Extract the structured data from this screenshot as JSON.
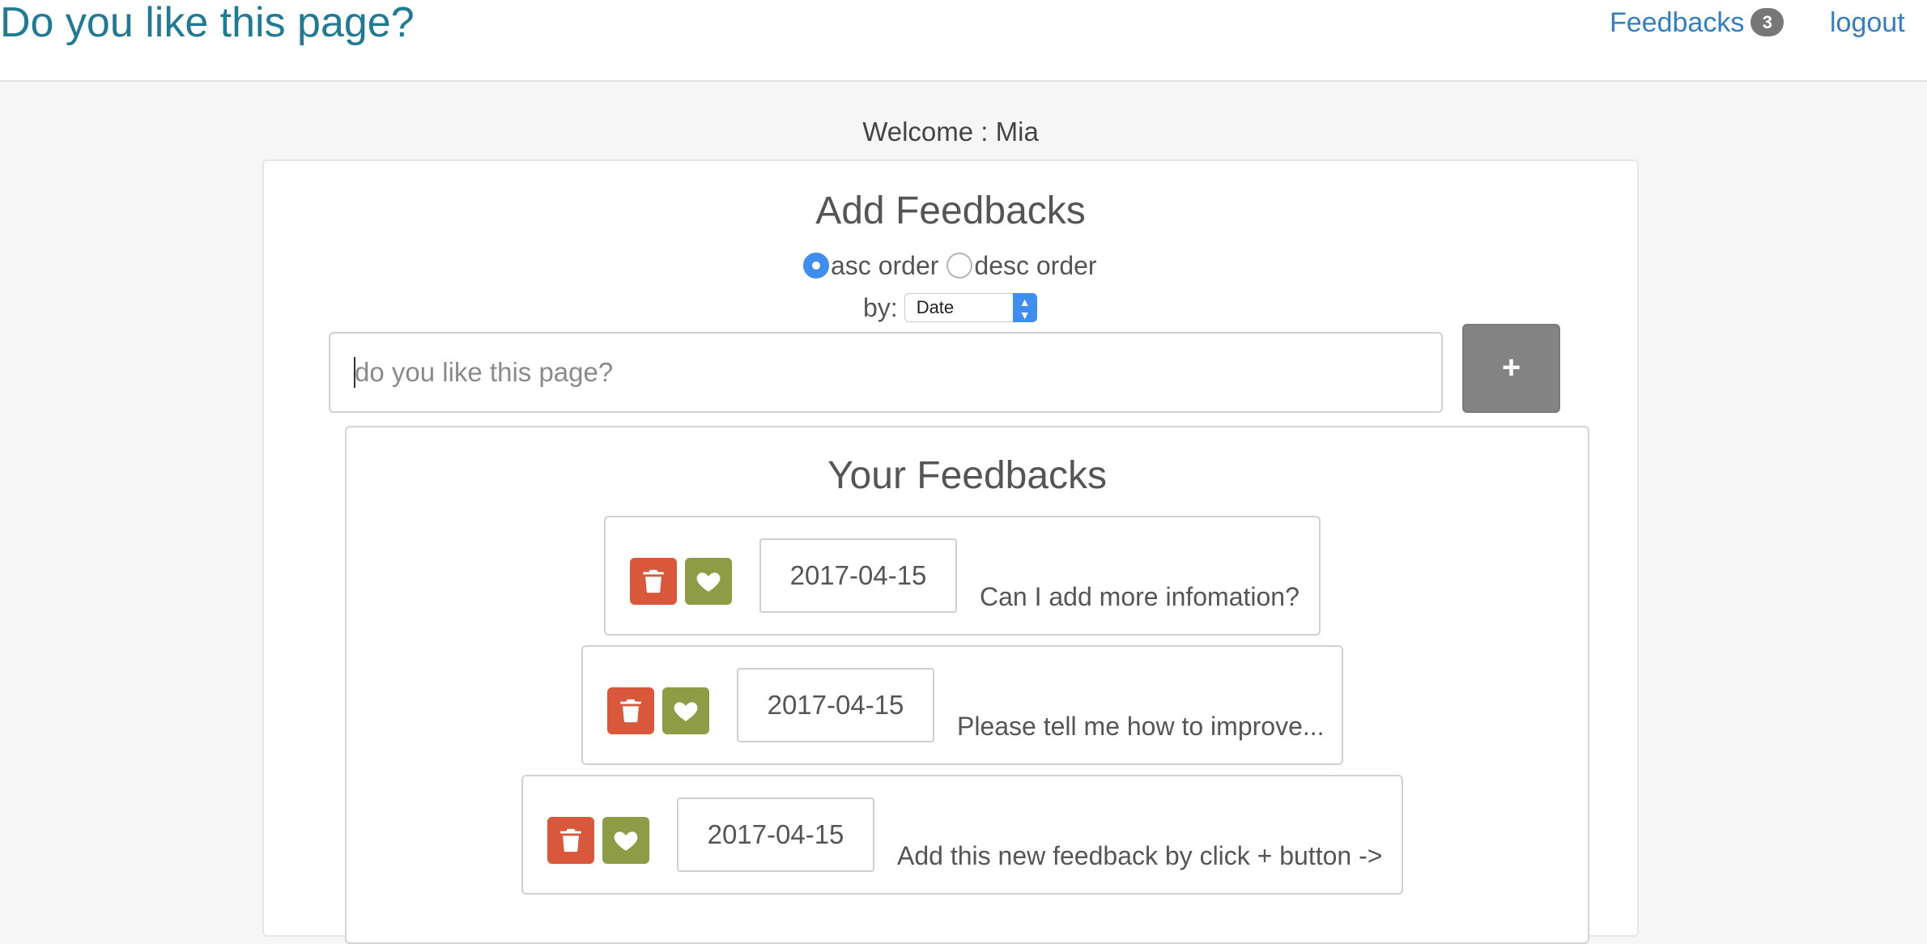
{
  "header": {
    "brand": "Do you like this page?",
    "feedbacks_link": "Feedbacks",
    "feedbacks_count": "3",
    "logout": "logout"
  },
  "welcome": "Welcome : Mia",
  "add_panel": {
    "title": "Add Feedbacks",
    "order_options": [
      "asc order",
      "desc order"
    ],
    "order_selected": "asc order",
    "by_label": "by:",
    "sort_by_value": "Date",
    "input_placeholder": "do you like this page?",
    "input_value": "",
    "add_button_label": "+"
  },
  "feedback_list": {
    "title": "Your Feedbacks",
    "items": [
      {
        "date": "2017-04-15",
        "text": "Can I add more infomation?"
      },
      {
        "date": "2017-04-15",
        "text": "Please tell me how to improve..."
      },
      {
        "date": "2017-04-15",
        "text": "Add this new feedback by click + button ->"
      }
    ]
  },
  "colors": {
    "brand": "#1f7a95",
    "link": "#2f7fc6",
    "delete_button": "#d9573a",
    "like_button": "#8e9d45",
    "add_button": "#838383",
    "radio_checked": "#3d8ef0"
  },
  "icons": {
    "delete": "trash-icon",
    "like": "heart-icon"
  }
}
